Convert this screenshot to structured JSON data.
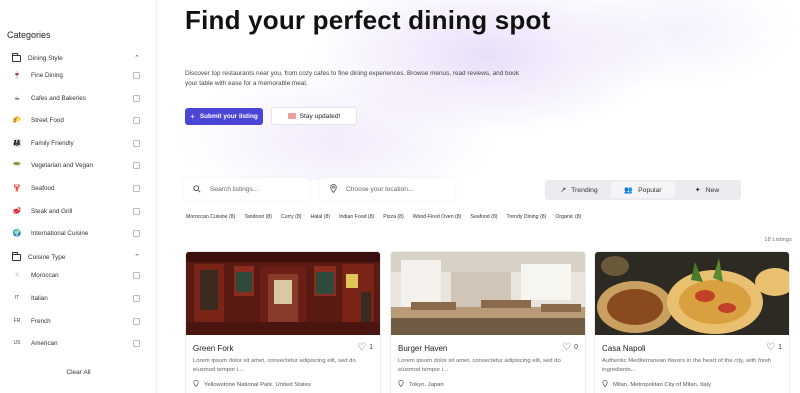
{
  "sidebar": {
    "title": "Categories",
    "groups": [
      {
        "label": "Dining Style",
        "items": [
          {
            "label": "Fine Dining",
            "icon": "🍷"
          },
          {
            "label": "Cafes and Bakeries",
            "icon": "☕"
          },
          {
            "label": "Street Food",
            "icon": "🌮"
          },
          {
            "label": "Family Friendly",
            "icon": "👨‍👩‍👧"
          },
          {
            "label": "Vegetarian and Vegan",
            "icon": "🥗"
          },
          {
            "label": "Seafood",
            "icon": "🦞"
          },
          {
            "label": "Steak and Grill",
            "icon": "🥩"
          },
          {
            "label": "International Cuisine",
            "icon": "🌍"
          }
        ]
      },
      {
        "label": "Cuisine Type",
        "items": [
          {
            "label": "Moroccan",
            "code": "☆"
          },
          {
            "label": "Italian",
            "code": "IT"
          },
          {
            "label": "French",
            "code": "FR"
          },
          {
            "label": "American",
            "code": "US"
          }
        ]
      }
    ],
    "clear_all": "Clear All"
  },
  "hero": {
    "title": "Find your perfect dining spot",
    "description": "Discover top restaurants near you, from cozy cafes to fine dining experiences. Browse menus, read reviews, and book your table with ease for a memorable meal.",
    "primary_button": "Submit your listing",
    "secondary_button": "Stay updated!"
  },
  "search": {
    "listings_placeholder": "Search listings...",
    "location_placeholder": "Choose your location..."
  },
  "sort_tabs": [
    {
      "label": "Trending",
      "icon": "↗"
    },
    {
      "label": "Popular",
      "icon": "👥"
    },
    {
      "label": "New",
      "icon": "✦"
    }
  ],
  "active_sort": "Popular",
  "tags": [
    "Moroccan Cuisine (8)",
    "Tandoori (8)",
    "Curry (8)",
    "Halal (8)",
    "Indian Food (8)",
    "Pizza (8)",
    "Wood-Fired Oven (8)",
    "Seafood (8)",
    "Trendy Dining (8)",
    "Organic (8)"
  ],
  "listing_count": "18 Listings",
  "cards": [
    {
      "name": "Green Fork",
      "likes": "1",
      "description": "Lorem ipsum dolor sit amet, consectetur adipiscing elit, sed do eiusmod tempor i...",
      "location": "Yellowstone National Park, United States"
    },
    {
      "name": "Burger Haven",
      "likes": "0",
      "description": "Lorem ipsum dolor sit amet, consectetur adipiscing elit, sed do eiusmod tempor i...",
      "location": "Tokyo, Japan"
    },
    {
      "name": "Casa Napoli",
      "likes": "1",
      "description": "Authentic Mediterranean flavors in the heart of the city, with fresh ingredients...",
      "location": "Milan, Metropolitan City of Milan, Italy"
    }
  ],
  "colors": {
    "accent": "#4b45d6",
    "hero_glow": "#d8c4f5"
  }
}
